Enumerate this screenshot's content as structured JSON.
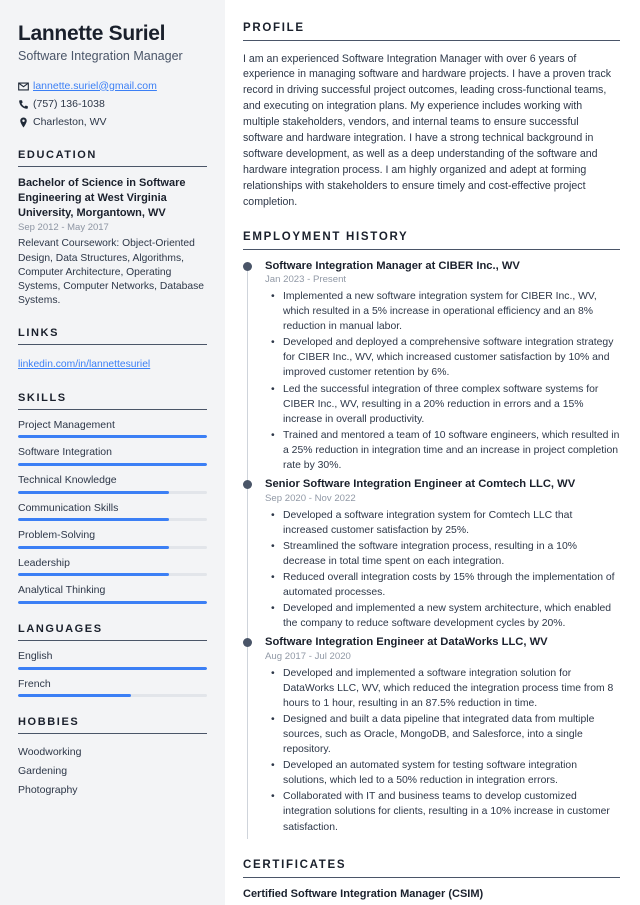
{
  "sidebar": {
    "name": "Lannette Suriel",
    "job_title": "Software Integration Manager",
    "contacts": [
      {
        "icon": "envelope-icon",
        "value": "lannette.suriel@gmail.com",
        "is_link": true
      },
      {
        "icon": "phone-icon",
        "value": "(757) 136-1038",
        "is_link": false
      },
      {
        "icon": "location-pin-icon",
        "value": "Charleston, WV",
        "is_link": false
      }
    ],
    "education": {
      "heading": "EDUCATION",
      "degree": "Bachelor of Science in Software Engineering at West Virginia University, Morgantown, WV",
      "date": "Sep 2012 - May 2017",
      "description": "Relevant Coursework: Object-Oriented Design, Data Structures, Algorithms, Computer Architecture, Operating Systems, Computer Networks, Database Systems."
    },
    "links": {
      "heading": "LINKS",
      "items": [
        {
          "label": "linkedin.com/in/lannettesuriel"
        }
      ]
    },
    "skills": {
      "heading": "SKILLS",
      "items": [
        {
          "label": "Project Management",
          "level": 100
        },
        {
          "label": "Software Integration",
          "level": 100
        },
        {
          "label": "Technical Knowledge",
          "level": 80
        },
        {
          "label": "Communication Skills",
          "level": 80
        },
        {
          "label": "Problem-Solving",
          "level": 80
        },
        {
          "label": "Leadership",
          "level": 80
        },
        {
          "label": "Analytical Thinking",
          "level": 100
        }
      ]
    },
    "languages": {
      "heading": "LANGUAGES",
      "items": [
        {
          "label": "English",
          "level": 100
        },
        {
          "label": "French",
          "level": 60
        }
      ]
    },
    "hobbies": {
      "heading": "HOBBIES",
      "items": [
        {
          "label": "Woodworking"
        },
        {
          "label": "Gardening"
        },
        {
          "label": "Photography"
        }
      ]
    }
  },
  "main": {
    "profile": {
      "heading": "PROFILE",
      "text": "I am an experienced Software Integration Manager with over 6 years of experience in managing software and hardware projects. I have a proven track record in driving successful project outcomes, leading cross-functional teams, and executing on integration plans. My experience includes working with multiple stakeholders, vendors, and internal teams to ensure successful software and hardware integration. I have a strong technical background in software development, as well as a deep understanding of the software and hardware integration process. I am highly organized and adept at forming relationships with stakeholders to ensure timely and cost-effective project completion."
    },
    "employment": {
      "heading": "EMPLOYMENT HISTORY",
      "jobs": [
        {
          "title": "Software Integration Manager at CIBER Inc., WV",
          "date": "Jan 2023 - Present",
          "bullets": [
            "Implemented a new software integration system for CIBER Inc., WV, which resulted in a 5% increase in operational efficiency and an 8% reduction in manual labor.",
            "Developed and deployed a comprehensive software integration strategy for CIBER Inc., WV, which increased customer satisfaction by 10% and improved customer retention by 6%.",
            "Led the successful integration of three complex software systems for CIBER Inc., WV, resulting in a 20% reduction in errors and a 15% increase in overall productivity.",
            "Trained and mentored a team of 10 software engineers, which resulted in a 25% reduction in integration time and an increase in project completion rate by 30%."
          ]
        },
        {
          "title": "Senior Software Integration Engineer at Comtech LLC, WV",
          "date": "Sep 2020 - Nov 2022",
          "bullets": [
            "Developed a software integration system for Comtech LLC that increased customer satisfaction by 25%.",
            "Streamlined the software integration process, resulting in a 10% decrease in total time spent on each integration.",
            "Reduced overall integration costs by 15% through the implementation of automated processes.",
            "Developed and implemented a new system architecture, which enabled the company to reduce software development cycles by 20%."
          ]
        },
        {
          "title": "Software Integration Engineer at DataWorks LLC, WV",
          "date": "Aug 2017 - Jul 2020",
          "bullets": [
            "Developed and implemented a software integration solution for DataWorks LLC, WV, which reduced the integration process time from 8 hours to 1 hour, resulting in an 87.5% reduction in time.",
            "Designed and built a data pipeline that integrated data from multiple sources, such as Oracle, MongoDB, and Salesforce, into a single repository.",
            "Developed an automated system for testing software integration solutions, which led to a 50% reduction in integration errors.",
            "Collaborated with IT and business teams to develop customized integration solutions for clients, resulting in a 10% increase in customer satisfaction."
          ]
        }
      ]
    },
    "certificates": {
      "heading": "CERTIFICATES",
      "items": [
        {
          "title": "Certified Software Integration Manager (CSIM)"
        }
      ]
    }
  },
  "colors": {
    "accent": "#3b7ff5",
    "sidebar_bg": "#f3f4f6",
    "heading": "#1a202c",
    "muted": "#9199a6"
  }
}
